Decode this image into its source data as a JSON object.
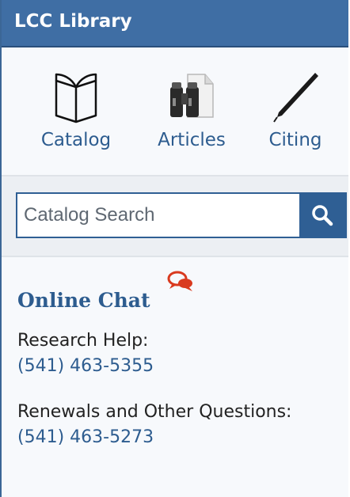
{
  "header": {
    "title": "LCC Library"
  },
  "nav": {
    "items": [
      {
        "label": "Catalog",
        "icon": "book-icon"
      },
      {
        "label": "Articles",
        "icon": "binoculars-icon"
      },
      {
        "label": "Citing",
        "icon": "pen-icon"
      }
    ]
  },
  "search": {
    "placeholder": "Catalog Search",
    "icon": "search-icon"
  },
  "chat": {
    "label": "Online Chat",
    "icon": "chat-bubbles-icon"
  },
  "contacts": [
    {
      "label": "Research Help:",
      "phone": "(541) 463-5355"
    },
    {
      "label": "Renewals and Other Questions:",
      "phone": "(541) 463-5273"
    }
  ],
  "colors": {
    "header_bg": "#3f6ea4",
    "link": "#2d5c8f",
    "accent": "#2f5f94",
    "chat_icon": "#d93a1f"
  }
}
